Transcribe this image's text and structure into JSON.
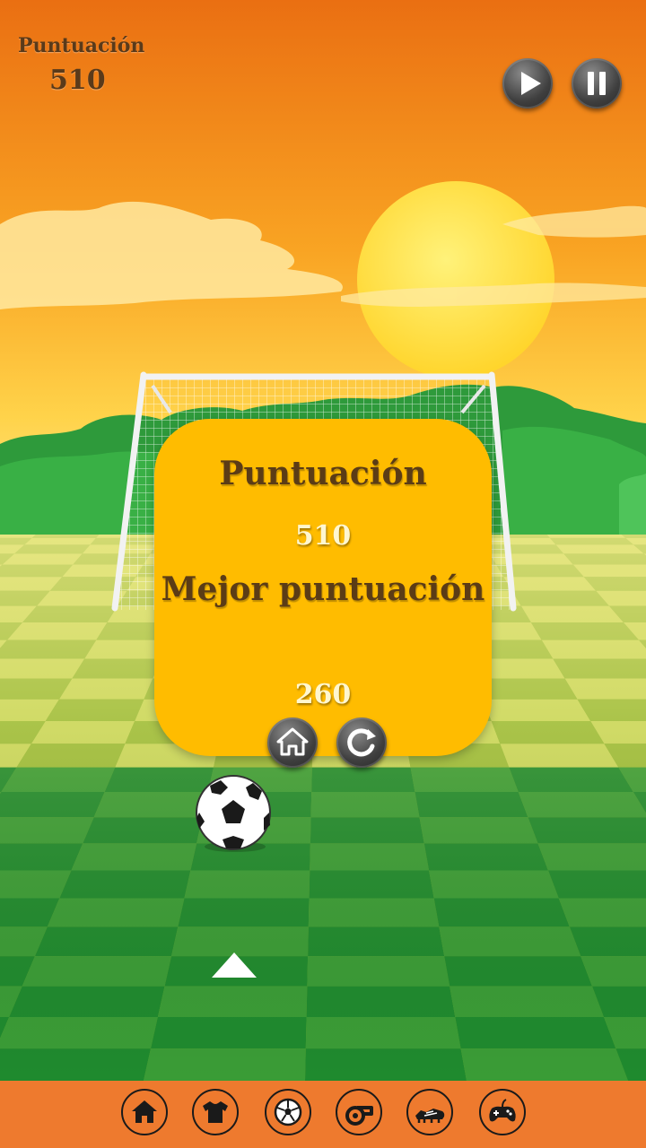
{
  "hud": {
    "score_label": "Puntuación",
    "score_value": "510"
  },
  "controls": {
    "play_icon": "play-icon",
    "pause_icon": "pause-icon"
  },
  "result_panel": {
    "score_label": "Puntuación",
    "score_value": "510",
    "best_label": "Mejor puntuación",
    "best_value": "260",
    "home_icon": "home-icon",
    "restart_icon": "restart-icon"
  },
  "bottom_nav": {
    "items": [
      "home-icon",
      "shirt-icon",
      "ball-icon",
      "whistle-icon",
      "boot-icon",
      "gamepad-icon"
    ]
  },
  "colors": {
    "sky_top": "#ea6f12",
    "sky_bottom": "#ffd24a",
    "panel": "#ffbc00",
    "bottom_bar": "#ee7a2e",
    "field_dark": "#1f8a2e",
    "field_light": "#c8d65c"
  }
}
